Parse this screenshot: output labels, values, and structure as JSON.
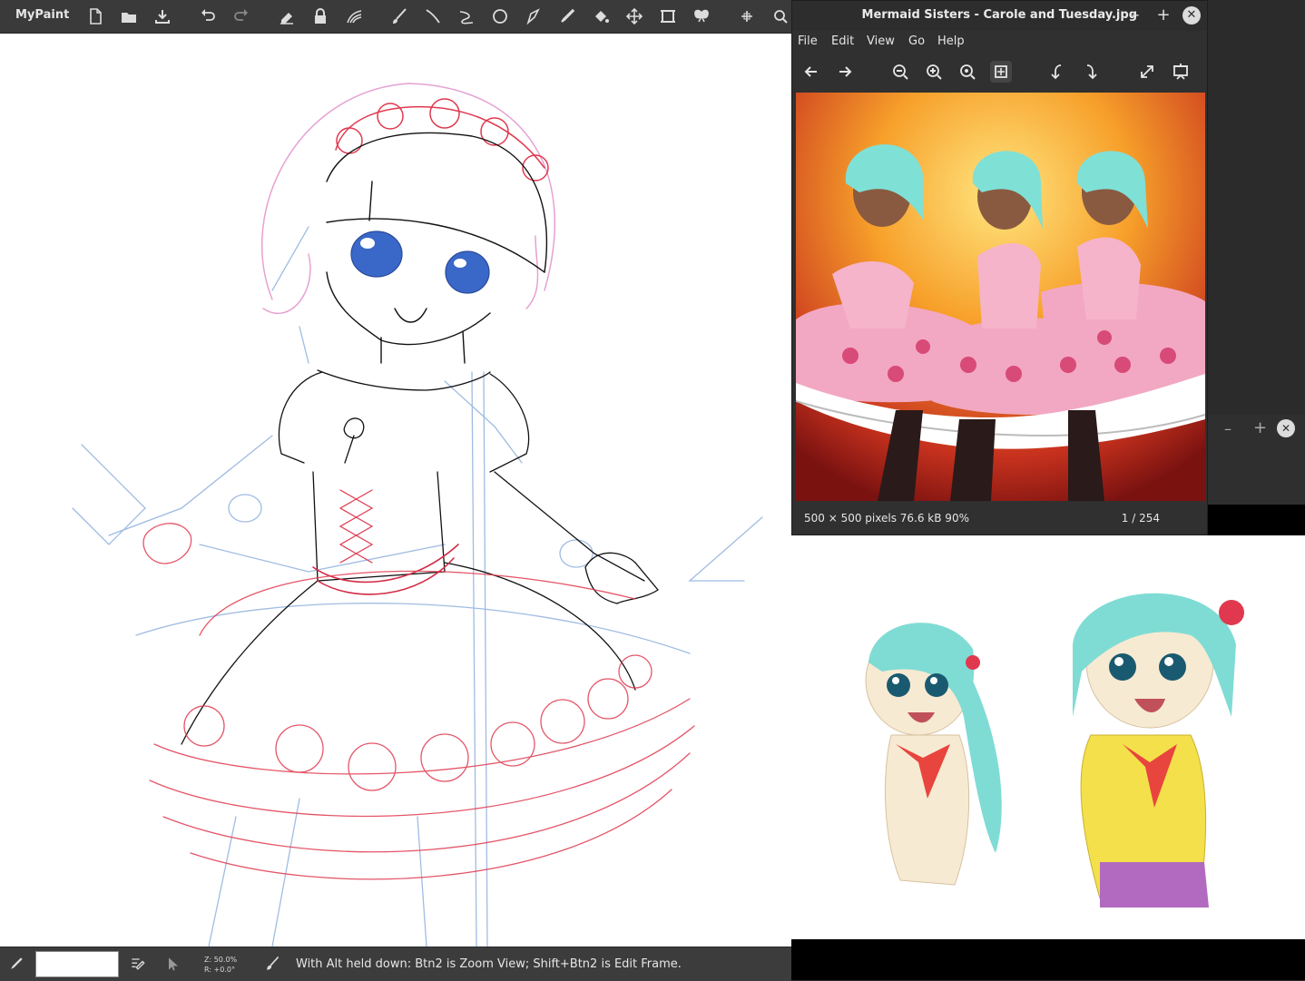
{
  "app": {
    "name": "MyPaint"
  },
  "toolbar": {
    "icons": [
      "new-file-icon",
      "open-file-icon",
      "save-file-icon",
      "undo-icon",
      "redo-icon",
      "eraser-icon",
      "lock-alpha-icon",
      "blend-icon",
      "brush-icon",
      "pen-icon",
      "inking-icon",
      "ellipse-icon",
      "freehand-icon",
      "pipette-icon",
      "fill-icon",
      "move-icon",
      "frame-icon",
      "symmetry-icon",
      "pan-icon",
      "zoom-icon"
    ]
  },
  "status": {
    "zoom": "Z: 50.0%",
    "rotation": "R: +0.0°",
    "message": "With Alt held down:  Btn2 is Zoom View;  Shift+Btn2 is Edit Frame."
  },
  "viewer": {
    "title": "Mermaid Sisters - Carole and Tuesday.jpg",
    "menu": [
      "File",
      "Edit",
      "View",
      "Go",
      "Help"
    ],
    "info": "500 × 500 pixels  76.6 kB   90%",
    "position": "1 / 254",
    "minimize": "–",
    "maximize": "+",
    "close": "✕"
  },
  "window2": {
    "minimize": "–",
    "maximize": "+",
    "close": "✕"
  },
  "colors": {
    "accent_pink": "#f4a7c0",
    "teal_hair": "#7fe0d6",
    "sketch_red": "#e0394f",
    "sketch_blue": "#7fa6d8"
  }
}
